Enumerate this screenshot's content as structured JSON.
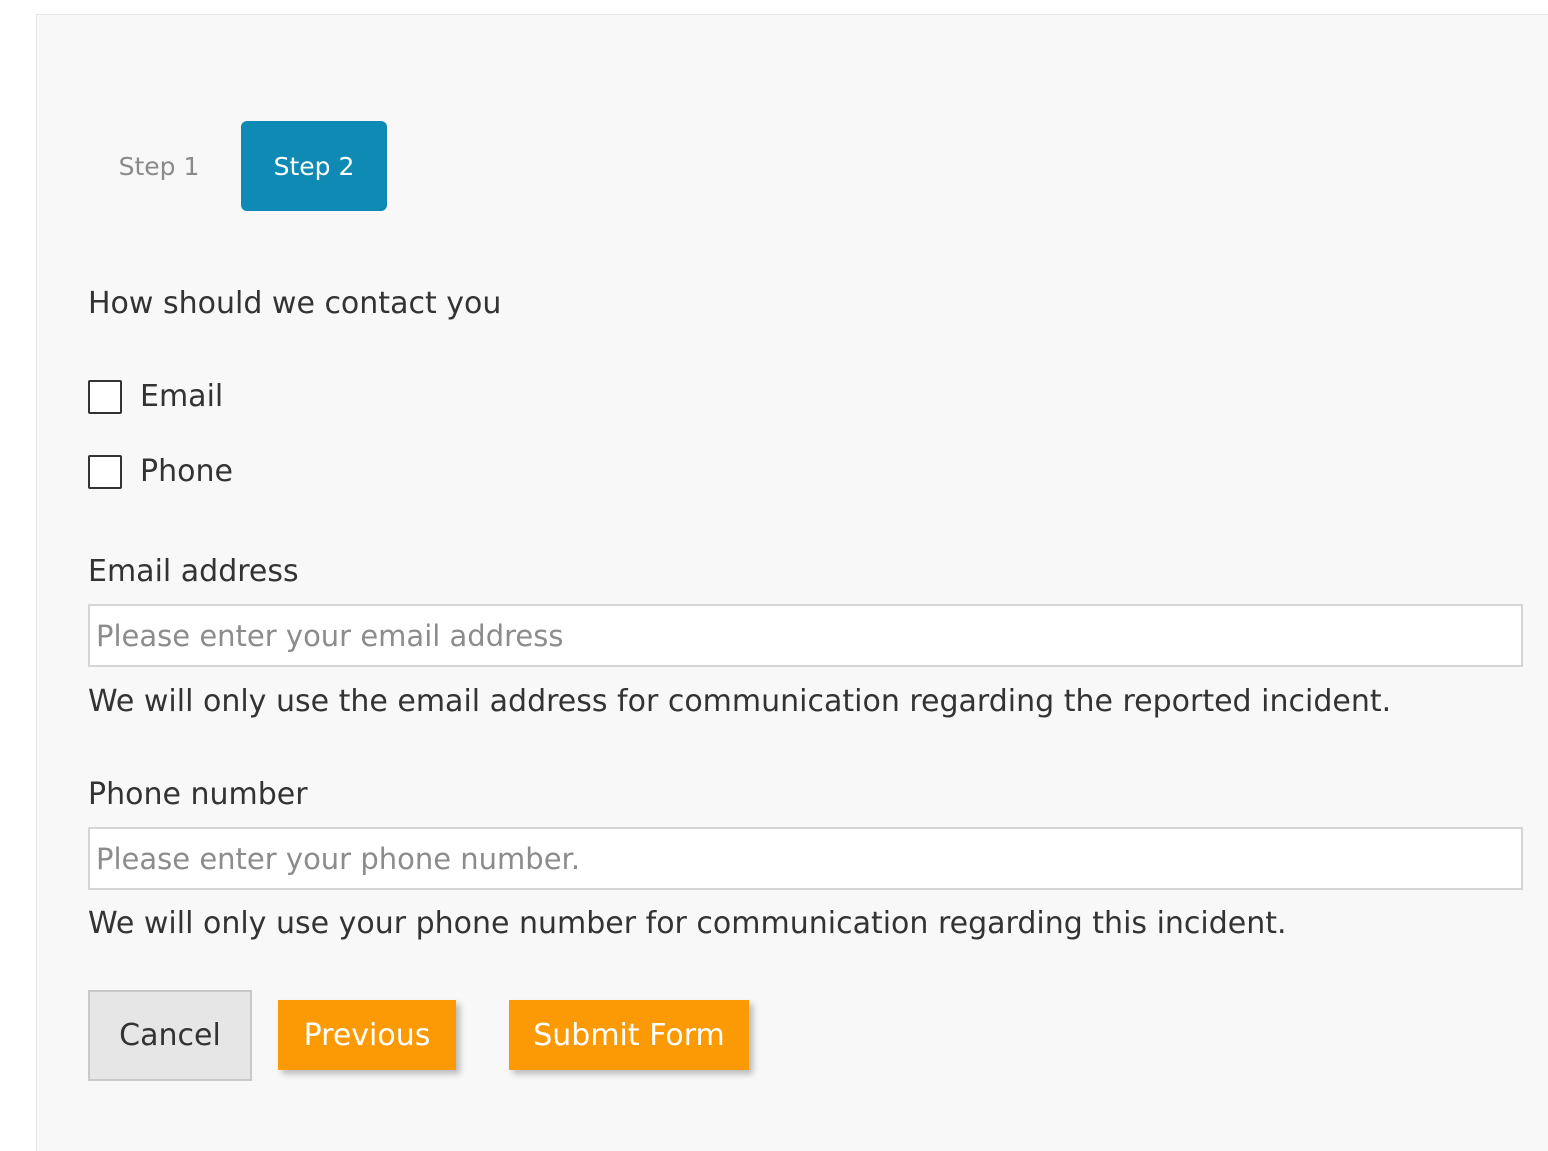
{
  "steps": [
    {
      "label": "Step 1",
      "active": false
    },
    {
      "label": "Step 2",
      "active": true
    }
  ],
  "contact": {
    "question": "How should we contact you",
    "options": [
      {
        "label": "Email",
        "checked": false
      },
      {
        "label": "Phone",
        "checked": false
      }
    ]
  },
  "email": {
    "label": "Email address",
    "value": "",
    "placeholder": "Please enter your email address",
    "help": "We will only use the email address for communication regarding the reported incident."
  },
  "phone": {
    "label": "Phone number",
    "value": "",
    "placeholder": "Please enter your phone number.",
    "help": "We will only use your phone number for communication regarding this incident."
  },
  "buttons": {
    "cancel": "Cancel",
    "previous": "Previous",
    "submit": "Submit Form"
  },
  "colors": {
    "step_active": "#0f8ab5",
    "primary_button": "#fb9a05",
    "cancel_button": "#e6e6e6",
    "panel_background": "#f8f8f8"
  }
}
